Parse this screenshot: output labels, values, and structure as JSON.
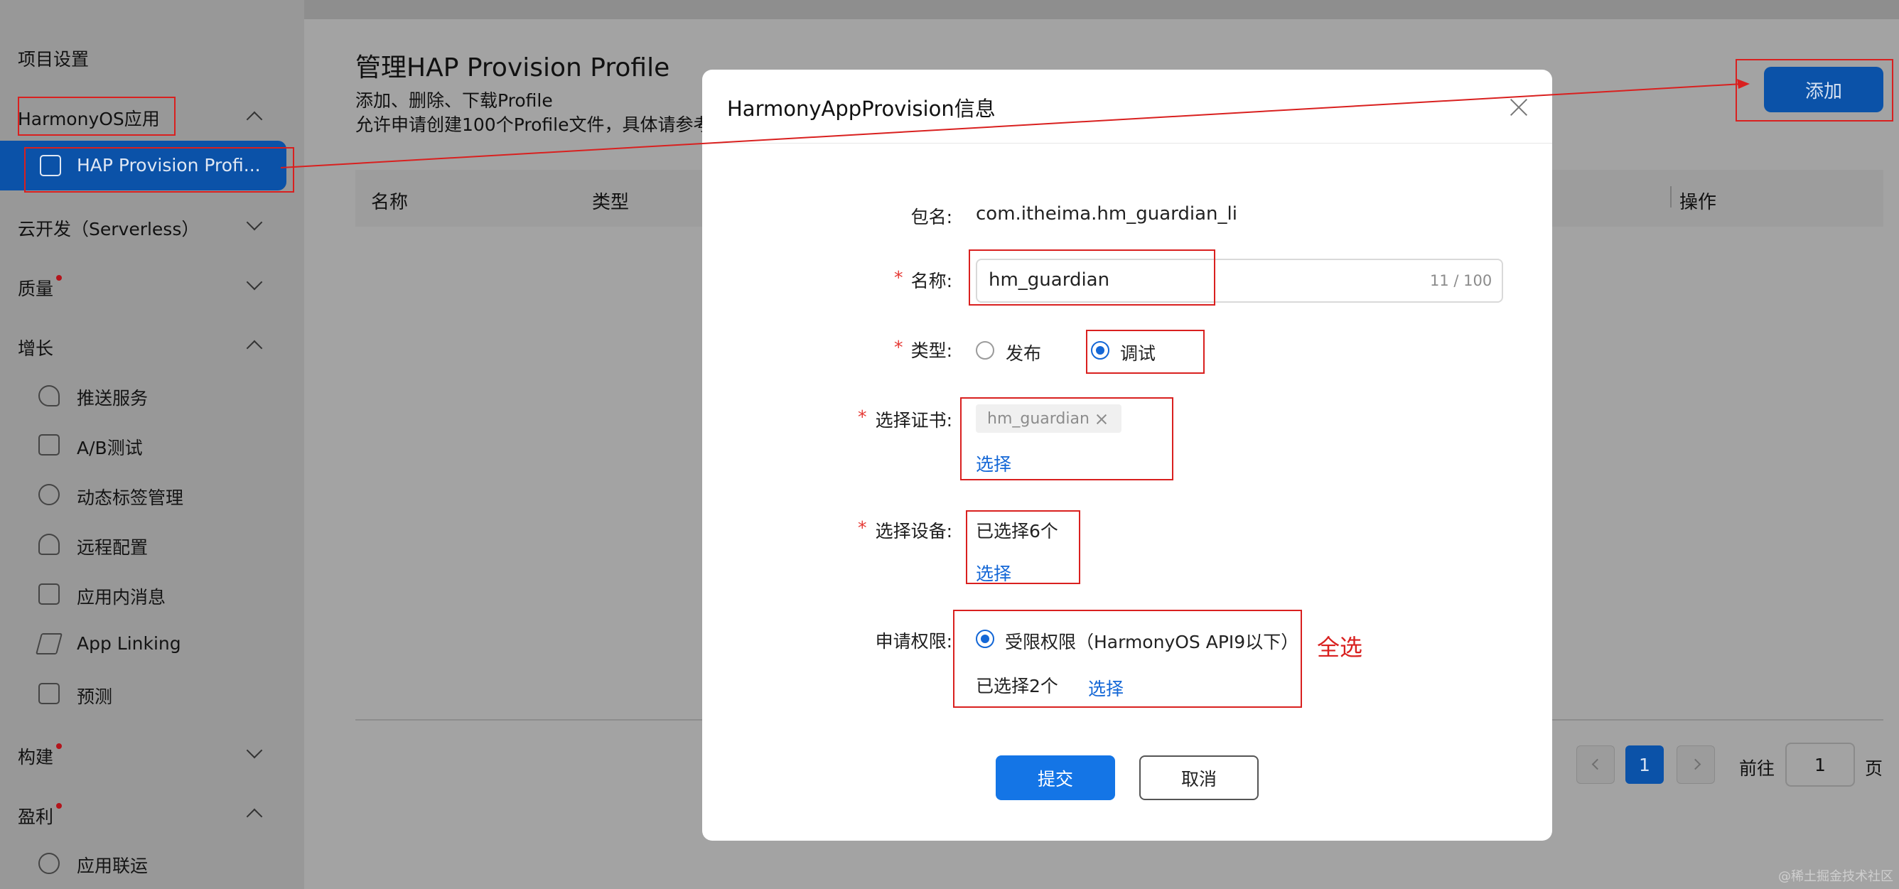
{
  "sidebar": {
    "project_settings": "项目设置",
    "harmony_app": "HarmonyOS应用",
    "hap_item": "HAP Provision Profi...",
    "cloud_dev": "云开发（Serverless）",
    "quality": "质量",
    "growth": "增长",
    "growth_items": [
      "推送服务",
      "A/B测试",
      "动态标签管理",
      "远程配置",
      "应用内消息",
      "App Linking",
      "预测"
    ],
    "build": "构建",
    "monetize": "盈利",
    "monetize_items": [
      "应用联运"
    ]
  },
  "main": {
    "title": "管理HAP Provision Profile",
    "desc1": "添加、删除、下载Profile",
    "desc2": "允许申请创建100个Profile文件，具体请参考",
    "add_button": "添加",
    "table_headers": [
      "名称",
      "类型",
      "操作"
    ],
    "pagination": {
      "current_page": "1",
      "goto_label": "前往",
      "goto_value": "1",
      "page_unit": "页"
    }
  },
  "dialog": {
    "title": "HarmonyAppProvision信息",
    "package_label": "包名:",
    "package_value": "com.itheima.hm_guardian_li",
    "name_label": "名称:",
    "name_value": "hm_guardian",
    "name_counter": "11 / 100",
    "type_label": "类型:",
    "type_release": "发布",
    "type_debug": "调试",
    "cert_label": "选择证书:",
    "cert_tag": "hm_guardian",
    "cert_select": "选择",
    "device_label": "选择设备:",
    "device_selected": "已选择6个",
    "device_select": "选择",
    "perm_label": "申请权限:",
    "perm_option": "受限权限（HarmonyOS API9以下）",
    "perm_selected": "已选择2个",
    "perm_select": "选择",
    "submit": "提交",
    "cancel": "取消",
    "required_mark": "*"
  },
  "annotation": {
    "select_all": "全选"
  },
  "watermark": "@稀土掘金技术社区",
  "colors": {
    "primary": "#1467d6",
    "annotation_red": "#d9201f",
    "required_red": "#e53935"
  }
}
